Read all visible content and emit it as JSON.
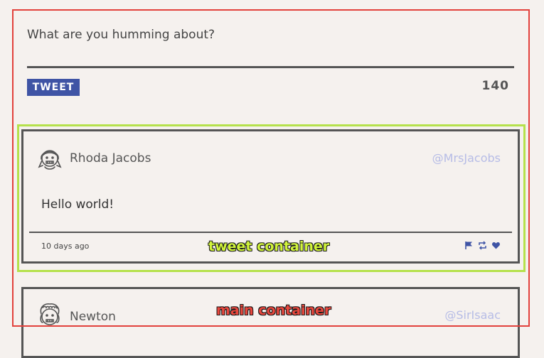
{
  "compose": {
    "placeholder": "What are you humming about?",
    "button_label": "TWEET",
    "char_count": "140"
  },
  "tweets": [
    {
      "name": "Rhoda Jacobs",
      "handle": "@MrsJacobs",
      "text": "Hello world!",
      "timestamp": "10 days ago",
      "avatar_icon": "girl-avatar-icon"
    },
    {
      "name": "Newton",
      "handle": "@SirIsaac",
      "avatar_icon": "curly-hair-avatar-icon"
    }
  ],
  "actions": [
    "flag-icon",
    "retweet-icon",
    "like-icon"
  ],
  "annotations": {
    "tweet_container": "tweet container",
    "main_container": "main container"
  },
  "colors": {
    "accent": "#3f54a5",
    "background": "#f5f1ee",
    "handle": "#b6bce6",
    "main_outline": "#e2413c",
    "tweet_outline": "#b5e14b"
  }
}
